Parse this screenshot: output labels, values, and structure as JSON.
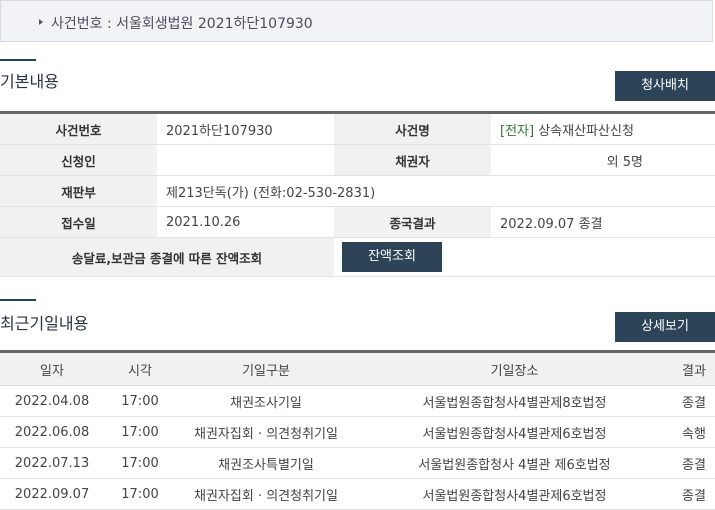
{
  "case_bar": {
    "text": "사건번호 : 서울회생법원 2021하단107930"
  },
  "basic": {
    "title": "기본내용",
    "button": "청사배치",
    "rows": [
      {
        "l1": "사건번호",
        "v1": "2021하단107930",
        "l2": "사건명",
        "tag": "[전자]",
        "v2": "상속재산파산신청"
      },
      {
        "l1": "신청인",
        "v1": "",
        "l2": "채권자",
        "v2": "외 5명"
      },
      {
        "l1": "재판부",
        "v1": "제213단독(가) (전화:02-530-2831)"
      },
      {
        "l1": "접수일",
        "v1": "2021.10.26",
        "l2": "종국결과",
        "v2": "2022.09.07 종결"
      }
    ],
    "balance_label": "송달료,보관금 종결에 따른 잔액조회",
    "balance_button": "잔액조회"
  },
  "recent": {
    "title": "최근기일내용",
    "button": "상세보기",
    "headers": [
      "일자",
      "시각",
      "기일구분",
      "기일장소",
      "결과"
    ],
    "rows": [
      [
        "2022.04.08",
        "17:00",
        "채권조사기일",
        "서울법원종합청사4별관제8호법정",
        "종결"
      ],
      [
        "2022.06.08",
        "17:00",
        "채권자집회 · 의견청취기일",
        "서울법원종합청사4별관제6호법정",
        "속행"
      ],
      [
        "2022.07.13",
        "17:00",
        "채권조사특별기일",
        "서울법원종합청사 4별관 제6호법정",
        "종결"
      ],
      [
        "2022.09.07",
        "17:00",
        "채권자집회 · 의견청취기일",
        "서울법원종합청사4별관제6호법정",
        "종결"
      ]
    ]
  }
}
